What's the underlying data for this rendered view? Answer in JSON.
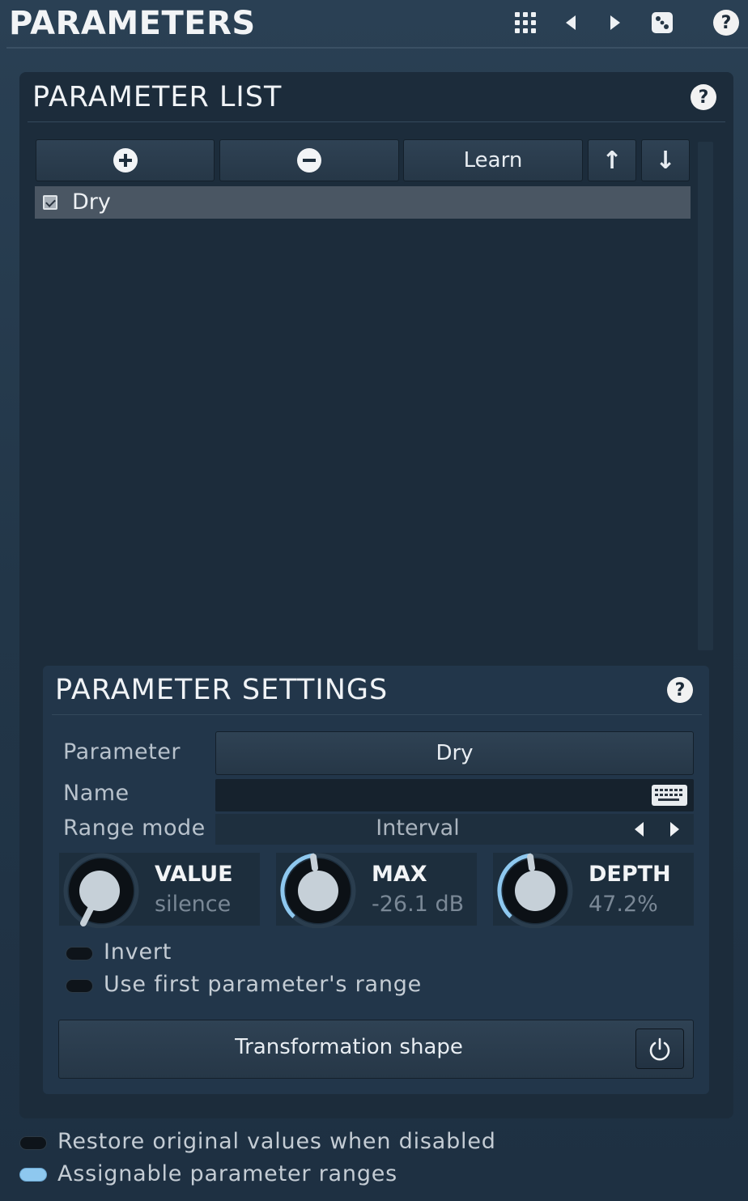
{
  "header": {
    "title": "PARAMETERS",
    "icons": [
      "grid-icon",
      "prev-icon",
      "next-icon",
      "dice-icon",
      "help-icon"
    ],
    "help_glyph": "?"
  },
  "parameter_list": {
    "title": "PARAMETER LIST",
    "help_glyph": "?",
    "toolbar": {
      "add_icon": "plus-circle-icon",
      "remove_icon": "minus-circle-icon",
      "learn_label": "Learn",
      "up_glyph": "↑",
      "down_glyph": "↓"
    },
    "items": [
      {
        "label": "Dry",
        "checked": true
      }
    ]
  },
  "parameter_settings": {
    "title": "PARAMETER SETTINGS",
    "help_glyph": "?",
    "parameter_label": "Parameter",
    "parameter_value": "Dry",
    "name_label": "Name",
    "name_value": "",
    "range_mode_label": "Range mode",
    "range_mode_value": "Interval",
    "knobs": [
      {
        "title": "VALUE",
        "value": "silence",
        "level": 0.0
      },
      {
        "title": "MAX",
        "value": "-26.1 dB",
        "level": 0.53
      },
      {
        "title": "DEPTH",
        "value": "47.2%",
        "level": 0.53
      }
    ],
    "invert_label": "Invert",
    "invert_on": false,
    "use_first_range_label": "Use first parameter's range",
    "use_first_range_on": false,
    "transformation_label": "Transformation shape",
    "transformation_power_icon": "power-icon"
  },
  "footer": {
    "restore_label": "Restore original values when disabled",
    "restore_on": false,
    "assignable_label": "Assignable parameter ranges",
    "assignable_on": true
  },
  "colors": {
    "background": "#223648",
    "panel": "#1c2c3b",
    "settings_panel": "#22364a",
    "toggle_on": "#8ec8ef",
    "knob_arc": "#8ec8ef"
  }
}
